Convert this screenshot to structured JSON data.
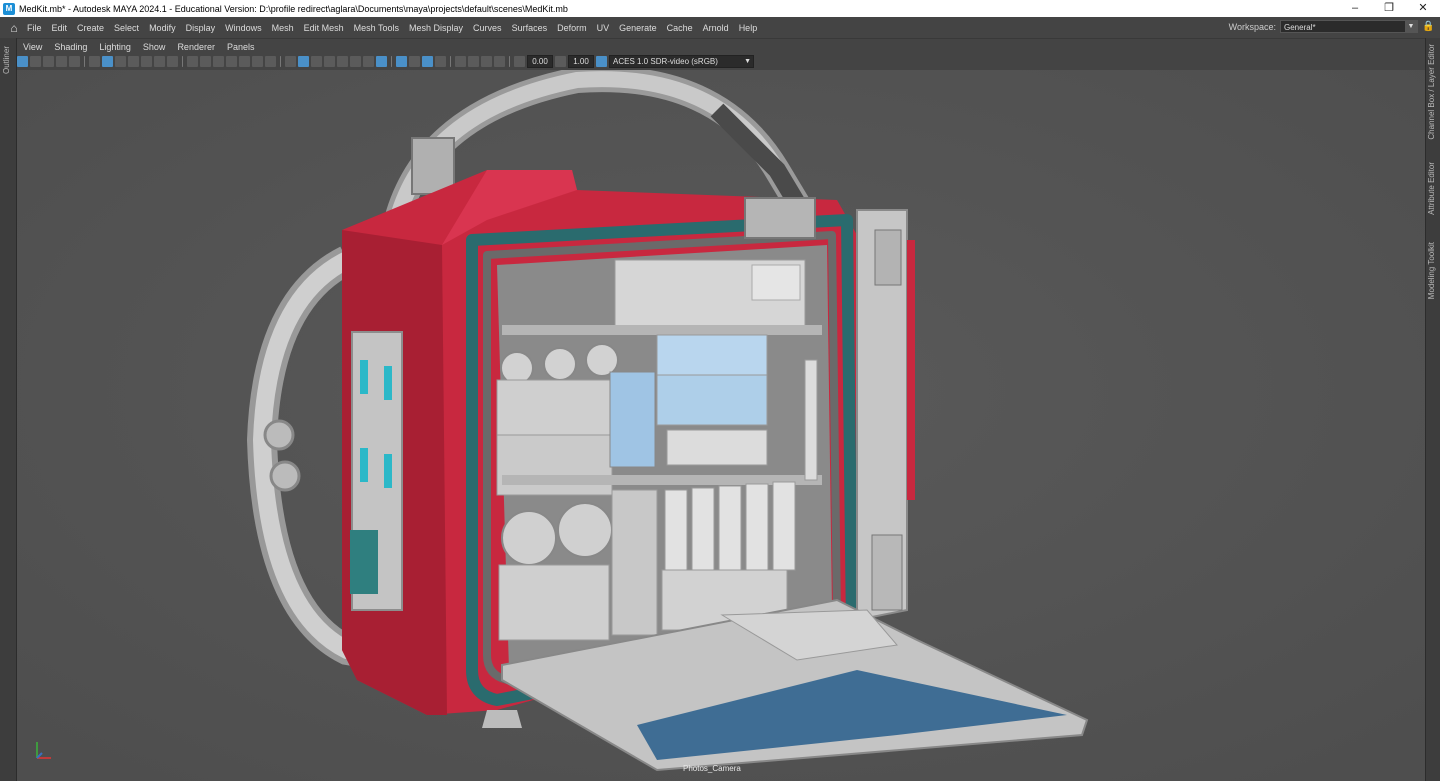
{
  "window": {
    "title": "MedKit.mb* - Autodesk MAYA 2024.1 - Educational Version: D:\\profile redirect\\aglara\\Documents\\maya\\projects\\default\\scenes\\MedKit.mb",
    "app_icon": "M"
  },
  "menu": [
    "File",
    "Edit",
    "Create",
    "Select",
    "Modify",
    "Display",
    "Windows",
    "Mesh",
    "Edit Mesh",
    "Mesh Tools",
    "Mesh Display",
    "Curves",
    "Surfaces",
    "Deform",
    "UV",
    "Generate",
    "Cache",
    "Arnold",
    "Help"
  ],
  "workspace": {
    "label": "Workspace:",
    "value": "General*"
  },
  "left_panel": {
    "label": "Outliner"
  },
  "right_panels": [
    "Channel Box / Layer Editor",
    "Attribute Editor",
    "Modeling Toolkit"
  ],
  "panel_menu": [
    "View",
    "Shading",
    "Lighting",
    "Show",
    "Renderer",
    "Panels"
  ],
  "toolbar": {
    "exposure": "0.00",
    "gamma": "1.00",
    "color_space": "ACES 1.0 SDR-video (sRGB)"
  },
  "viewport": {
    "camera": "Photos_Camera"
  },
  "colors": {
    "case_red": "#c8283f",
    "teal": "#2a6b6e",
    "grey_model": "#bdbdbd",
    "viewport_bg": "#555555",
    "lid_blue": "#3f6d94"
  }
}
